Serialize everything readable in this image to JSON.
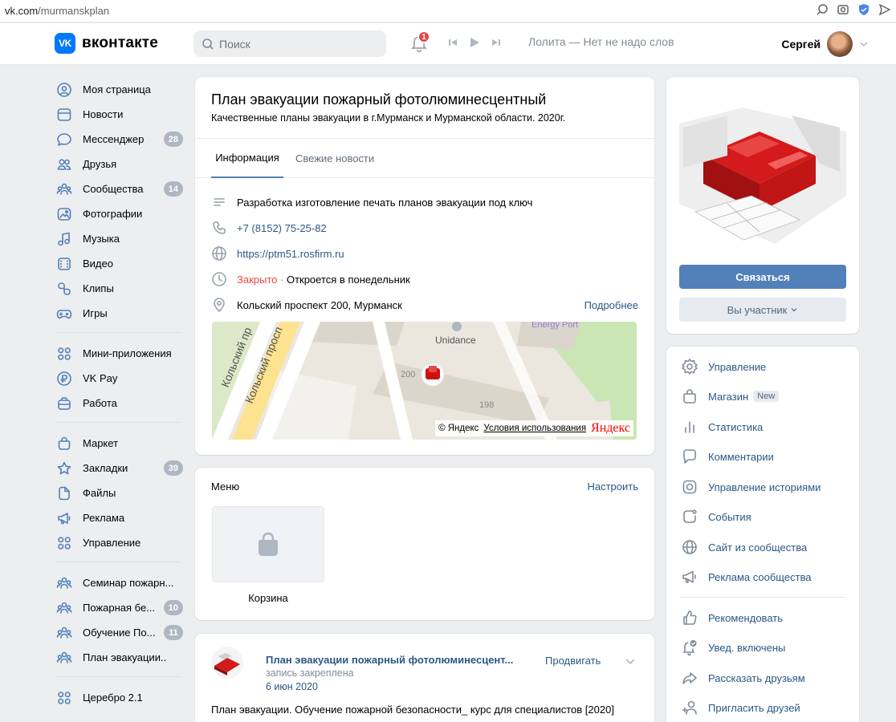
{
  "browser": {
    "url_host": "vk.com",
    "url_path": "/murmanskplan"
  },
  "header": {
    "logo_mark": "VK",
    "logo_text": "вконтакте",
    "search_placeholder": "Поиск",
    "notifications_count": "1",
    "now_playing": "Лолита — Нет не надо слов",
    "user_name": "Сергей"
  },
  "sidebar": {
    "items": [
      {
        "label": "Моя страница",
        "icon": "user-circle-icon",
        "count": ""
      },
      {
        "label": "Новости",
        "icon": "news-icon",
        "count": ""
      },
      {
        "label": "Мессенджер",
        "icon": "chat-bubble-icon",
        "count": "28"
      },
      {
        "label": "Друзья",
        "icon": "friends-icon",
        "count": ""
      },
      {
        "label": "Сообщества",
        "icon": "communities-icon",
        "count": "14"
      },
      {
        "label": "Фотографии",
        "icon": "photo-icon",
        "count": ""
      },
      {
        "label": "Музыка",
        "icon": "music-note-icon",
        "count": ""
      },
      {
        "label": "Видео",
        "icon": "video-icon",
        "count": ""
      },
      {
        "label": "Клипы",
        "icon": "clips-icon",
        "count": ""
      },
      {
        "label": "Игры",
        "icon": "gamepad-icon",
        "count": ""
      },
      {
        "label": "Мини-приложения",
        "icon": "apps-grid-icon",
        "count": ""
      },
      {
        "label": "VK Pay",
        "icon": "vkpay-icon",
        "count": ""
      },
      {
        "label": "Работа",
        "icon": "briefcase-icon",
        "count": ""
      },
      {
        "label": "Маркет",
        "icon": "shopping-bag-icon",
        "count": ""
      },
      {
        "label": "Закладки",
        "icon": "star-icon",
        "count": "39"
      },
      {
        "label": "Файлы",
        "icon": "file-icon",
        "count": ""
      },
      {
        "label": "Реклама",
        "icon": "megaphone-icon",
        "count": ""
      },
      {
        "label": "Управление",
        "icon": "apps-grid-icon",
        "count": ""
      },
      {
        "label": "Семинар пожарн...",
        "icon": "communities-icon",
        "count": ""
      },
      {
        "label": "Пожарная бе...",
        "icon": "communities-icon",
        "count": "10"
      },
      {
        "label": "Обучение По...",
        "icon": "communities-icon",
        "count": "11"
      },
      {
        "label": "План эвакуации..",
        "icon": "communities-icon",
        "count": ""
      },
      {
        "label": "Церебро 2.1",
        "icon": "apps-grid-icon",
        "count": ""
      }
    ]
  },
  "group": {
    "title": "План эвакуации пожарный фотолюминесцентный",
    "status": "Качественные планы эвакуации в г.Мурманск и Мурманской области. 2020г.",
    "tabs": [
      "Информация",
      "Свежие новости"
    ],
    "description": "Разработка изготовление печать планов эвакуации под ключ",
    "phone": "+7 (8152) 75-25-82",
    "website": "https://ptm51.rosfirm.ru",
    "hours_closed": "Закрыто",
    "hours_sep": " · ",
    "hours_opens": "Откроется в понедельник",
    "address": "Кольский проспект 200, Мурманск",
    "address_more": "Подробнее"
  },
  "map": {
    "street1": "Кольский пр",
    "street2": "Кольский просп",
    "poi1": "Unidance",
    "poi2": "Energy Port",
    "num1": "200",
    "num2": "198",
    "copyright": "© Яндекс",
    "terms": "Условия использования",
    "brand": "Яндекс"
  },
  "menu": {
    "header": "Меню",
    "configure": "Настроить",
    "tile_label": "Корзина"
  },
  "post": {
    "author": "План эвакуации пожарный фотолюминесцент...",
    "pinned": "запись закреплена",
    "date": "6 июн 2020",
    "promote": "Продвигать",
    "text": "План эвакуации. Обучение пожарной безопасности_ курс для специалистов [2020]"
  },
  "right": {
    "contact_button": "Связаться",
    "member_button": "Вы участник",
    "actions": [
      {
        "label": "Управление",
        "icon": "gear-icon",
        "badge": ""
      },
      {
        "label": "Магазин",
        "icon": "shopping-bag-icon",
        "badge": "New"
      },
      {
        "label": "Статистика",
        "icon": "bar-chart-icon",
        "badge": ""
      },
      {
        "label": "Комментарии",
        "icon": "comment-icon",
        "badge": ""
      },
      {
        "label": "Управление историями",
        "icon": "stories-icon",
        "badge": ""
      },
      {
        "label": "События",
        "icon": "events-icon",
        "badge": ""
      },
      {
        "label": "Сайт из сообщества",
        "icon": "globe-icon",
        "badge": ""
      },
      {
        "label": "Реклама сообщества",
        "icon": "megaphone-icon",
        "badge": ""
      },
      {
        "label": "Рекомендовать",
        "icon": "thumbs-up-icon",
        "badge": ""
      },
      {
        "label": "Увед. включены",
        "icon": "bell-check-icon",
        "badge": ""
      },
      {
        "label": "Рассказать друзьям",
        "icon": "share-icon",
        "badge": ""
      },
      {
        "label": "Пригласить друзей",
        "icon": "add-user-icon",
        "badge": ""
      }
    ]
  },
  "colors": {
    "accent": "#5181b8",
    "link": "#2a5885",
    "logo_blue": "#0077ff",
    "alert_red": "#e64646"
  }
}
